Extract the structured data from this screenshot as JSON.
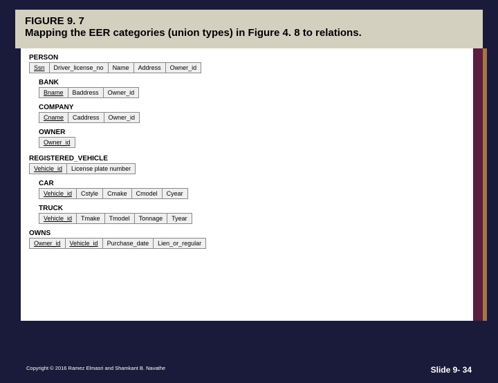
{
  "figure": {
    "number": "FIGURE 9. 7",
    "caption": "Mapping the EER categories (union types) in Figure 4. 8 to relations."
  },
  "relations": [
    {
      "name": "PERSON",
      "cols": [
        "Ssn",
        "Driver_license_no",
        "Name",
        "Address",
        "Owner_id"
      ],
      "pk": [
        0
      ]
    },
    {
      "name": "BANK",
      "cols": [
        "Bname",
        "Baddress",
        "Owner_id"
      ],
      "pk": [
        0
      ]
    },
    {
      "name": "COMPANY",
      "cols": [
        "Cname",
        "Caddress",
        "Owner_id"
      ],
      "pk": [
        0
      ]
    },
    {
      "name": "OWNER",
      "cols": [
        "Owner_id"
      ],
      "pk": [
        0
      ]
    },
    {
      "name": "REGISTERED_VEHICLE",
      "cols": [
        "Vehicle_id",
        "License plate number"
      ],
      "pk": [
        0
      ]
    },
    {
      "name": "CAR",
      "cols": [
        "Vehicle_id",
        "Cstyle",
        "Cmake",
        "Cmodel",
        "Cyear"
      ],
      "pk": [
        0
      ]
    },
    {
      "name": "TRUCK",
      "cols": [
        "Vehicle_id",
        "Tmake",
        "Tmodel",
        "Tonnage",
        "Tyear"
      ],
      "pk": [
        0
      ]
    },
    {
      "name": "OWNS",
      "cols": [
        "Owner_id",
        "Vehicle_id",
        "Purchase_date",
        "Lien_or_regular"
      ],
      "pk": [
        0,
        1
      ]
    }
  ],
  "footer": {
    "copyright": "Copyright © 2016 Ramez Elmasri and Shamkant B. Navathe",
    "slide": "Slide 9- 34"
  }
}
